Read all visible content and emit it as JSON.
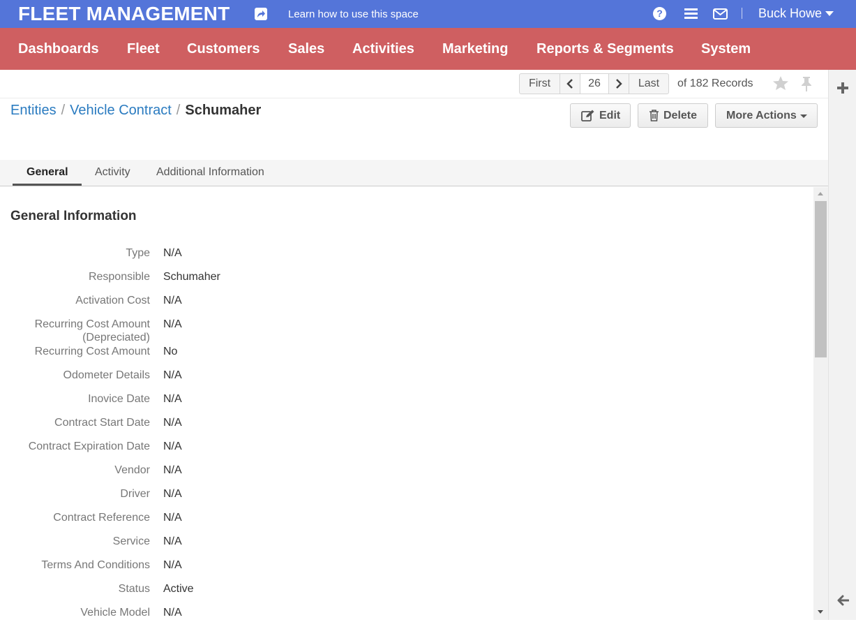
{
  "header": {
    "app_title": "FLEET MANAGEMENT",
    "learn_link": "Learn how to use this space",
    "help_glyph": "?",
    "user_name": "Buck Howe",
    "brand_color": "#5475d9"
  },
  "nav": {
    "items": [
      "Dashboards",
      "Fleet",
      "Customers",
      "Sales",
      "Activities",
      "Marketing",
      "Reports & Segments",
      "System"
    ],
    "color": "#cf5f61"
  },
  "pager": {
    "first": "First",
    "current": "26",
    "last": "Last",
    "records": "of 182 Records"
  },
  "breadcrumb": {
    "entities": "Entities",
    "sep": "/",
    "entity_type": "Vehicle Contract",
    "current": "Schumaher"
  },
  "actions": {
    "edit": "Edit",
    "delete": "Delete",
    "more": "More Actions"
  },
  "tabs": [
    "General",
    "Activity",
    "Additional Information"
  ],
  "section": {
    "title": "General Information",
    "fields": [
      {
        "label": "Type",
        "value": "N/A"
      },
      {
        "label": "Responsible",
        "value": "Schumaher"
      },
      {
        "label": "Activation Cost",
        "value": "N/A"
      },
      {
        "label": "Recurring Cost Amount (Depreciated)",
        "value": "N/A"
      },
      {
        "label": "Recurring Cost Amount",
        "value": "No"
      },
      {
        "label": "Odometer Details",
        "value": "N/A"
      },
      {
        "label": "Inovice Date",
        "value": "N/A"
      },
      {
        "label": "Contract Start Date",
        "value": "N/A"
      },
      {
        "label": "Contract Expiration Date",
        "value": "N/A"
      },
      {
        "label": "Vendor",
        "value": "N/A"
      },
      {
        "label": "Driver",
        "value": "N/A"
      },
      {
        "label": "Contract Reference",
        "value": "N/A"
      },
      {
        "label": "Service",
        "value": "N/A"
      },
      {
        "label": "Terms And Conditions",
        "value": "N/A"
      },
      {
        "label": "Status",
        "value": "Active"
      },
      {
        "label": "Vehicle Model",
        "value": "N/A"
      }
    ]
  }
}
